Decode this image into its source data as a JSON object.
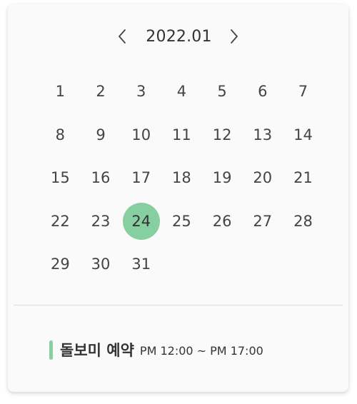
{
  "calendar": {
    "month_label": "2022.01",
    "prev_icon": "chevron-left-icon",
    "next_icon": "chevron-right-icon",
    "days": [
      [
        "1",
        "2",
        "3",
        "4",
        "5",
        "6",
        "7"
      ],
      [
        "8",
        "9",
        "10",
        "11",
        "12",
        "13",
        "14"
      ],
      [
        "15",
        "16",
        "17",
        "18",
        "19",
        "20",
        "21"
      ],
      [
        "22",
        "23",
        "24",
        "25",
        "26",
        "27",
        "28"
      ],
      [
        "29",
        "30",
        "31"
      ]
    ],
    "selected_day": "24",
    "selected_color": "#86cfa0"
  },
  "event": {
    "title": "돌보미 예약",
    "time": "PM 12:00 ~ PM 17:00",
    "color": "#86cfa0"
  }
}
